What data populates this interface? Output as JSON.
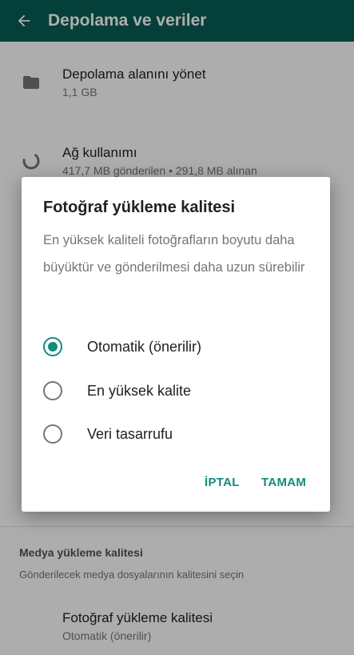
{
  "appbar": {
    "title": "Depolama ve veriler",
    "back_icon": "arrow-left-icon"
  },
  "storage": {
    "manage": {
      "title": "Depolama alanını yönet",
      "subtitle": "1,1 GB",
      "icon": "folder-icon"
    },
    "network": {
      "title": "Ağ kullanımı",
      "subtitle": "417,7 MB gönderilen • 291,8 MB alınan",
      "icon": "data-usage-icon"
    }
  },
  "media_quality": {
    "section_title": "Medya yükleme kalitesi",
    "section_subtitle": "Gönderilecek medya dosyalarının kalitesini seçin",
    "photo_title": "Fotoğraf yükleme kalitesi",
    "photo_value": "Otomatik (önerilir)"
  },
  "dialog": {
    "title": "Fotoğraf yükleme kalitesi",
    "message": "En yüksek kaliteli fotoğrafların boyutu daha büyüktür ve gönderilmesi daha uzun sürebilir",
    "options": [
      {
        "label": "Otomatik (önerilir)",
        "selected": true
      },
      {
        "label": "En yüksek kalite",
        "selected": false
      },
      {
        "label": "Veri tasarrufu",
        "selected": false
      }
    ],
    "cancel_label": "İPTAL",
    "ok_label": "TAMAM"
  },
  "colors": {
    "appbar": "#075e54",
    "accent": "#128c7e",
    "scrim": "rgba(0,0,0,0.32)"
  }
}
